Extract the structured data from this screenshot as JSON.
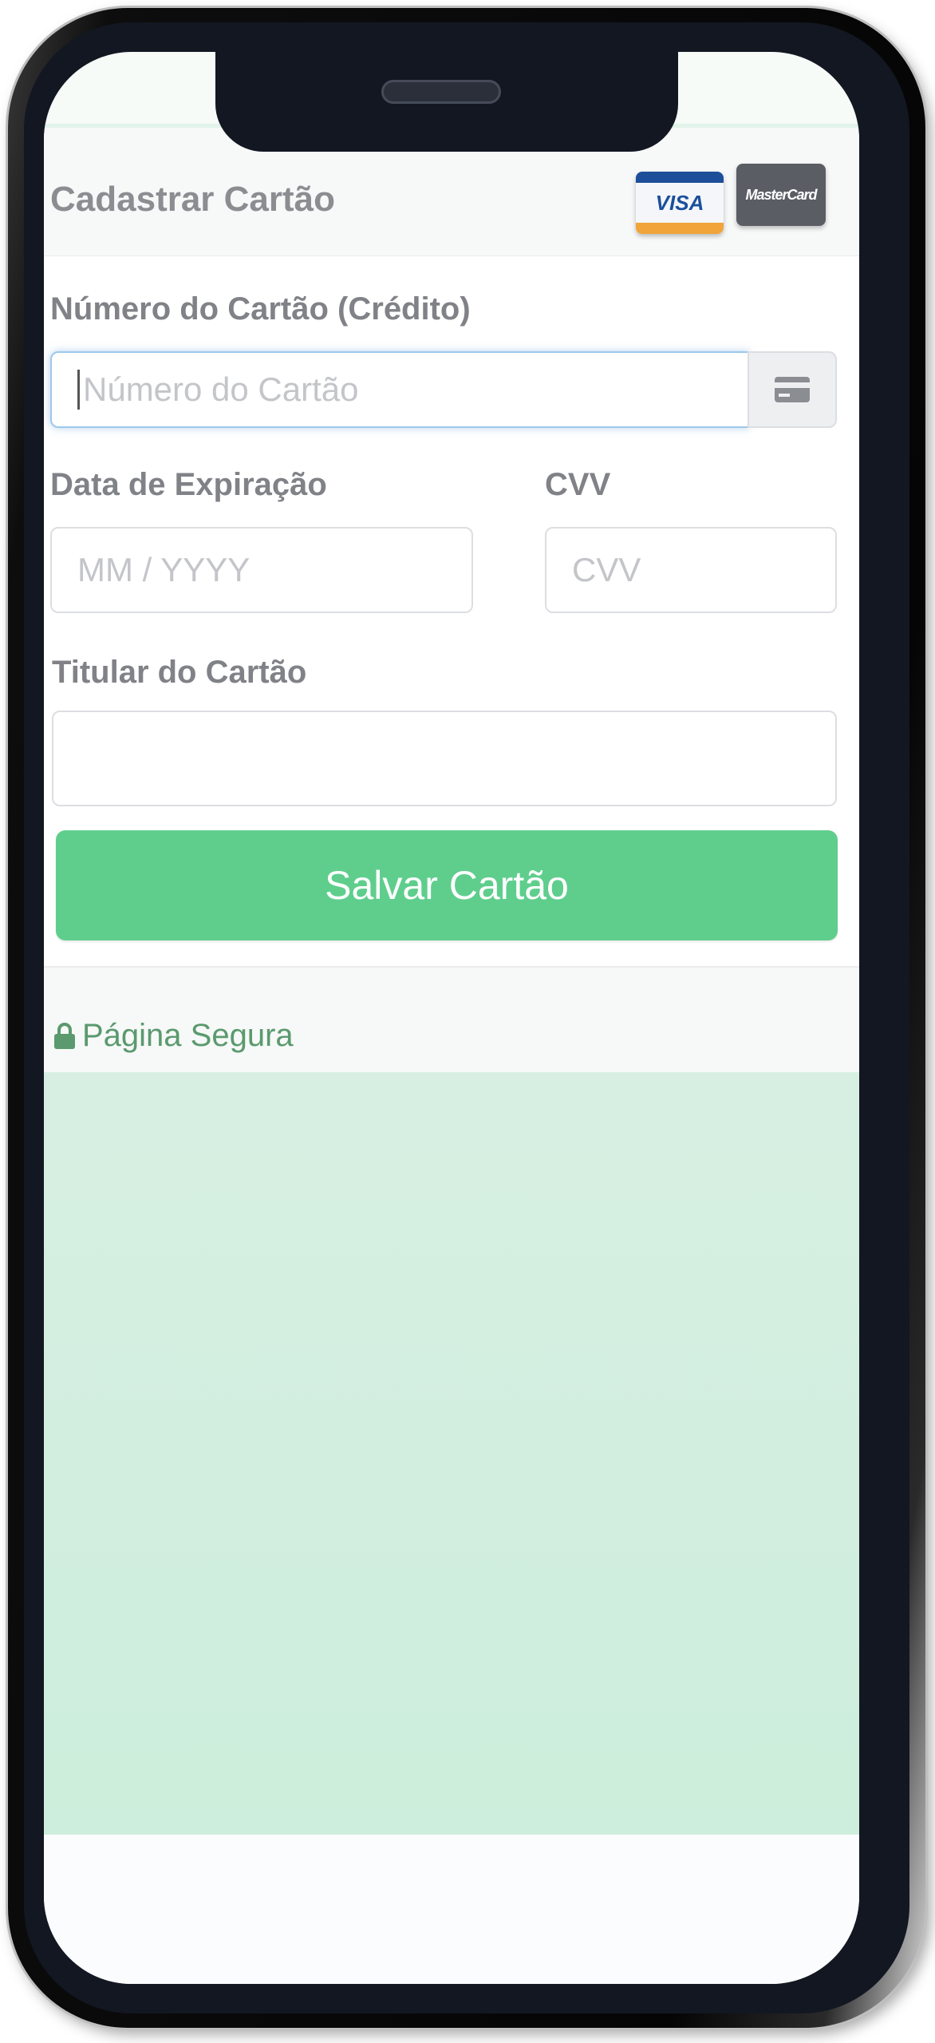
{
  "header": {
    "title": "Cadastrar Cartão"
  },
  "brands": {
    "visa": "VISA",
    "mastercard": "MasterCard"
  },
  "form": {
    "card_number": {
      "label": "Número do Cartão (Crédito)",
      "placeholder": "Número do Cartão",
      "value": ""
    },
    "expiration": {
      "label": "Data de Expiração",
      "placeholder": "MM / YYYY",
      "value": ""
    },
    "cvv": {
      "label": "CVV",
      "placeholder": "CVV",
      "value": ""
    },
    "holder": {
      "label": "Titular do Cartão",
      "placeholder": "",
      "value": ""
    }
  },
  "buttons": {
    "save": "Salvar Cartão"
  },
  "footer": {
    "secure_text": "Página Segura"
  },
  "icons": {
    "card_addon": "credit-card-icon",
    "secure": "lock-icon"
  },
  "colors": {
    "accent": "#5fce8d",
    "secure_text": "#5a9a6e",
    "background_green": "#d3eedf"
  }
}
